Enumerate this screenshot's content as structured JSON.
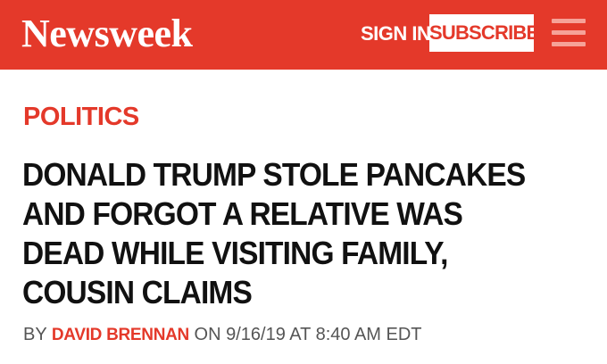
{
  "header": {
    "logo": "Newsweek",
    "sign_in": "SIGN IN",
    "subscribe": "SUBSCRIBE",
    "menu_icon": "hamburger-menu-icon",
    "brand_color": "#e4392a"
  },
  "article": {
    "section": "POLITICS",
    "headline": "DONALD TRUMP STOLE PANCAKES AND FORGOT A RELATIVE WAS DEAD WHILE VISITING FAMILY, COUSIN CLAIMS",
    "byline": {
      "by": "BY",
      "author": "DAVID BRENNAN",
      "on": "ON",
      "date": "9/16/19",
      "at": "AT",
      "time": "8:40 AM EDT"
    }
  }
}
